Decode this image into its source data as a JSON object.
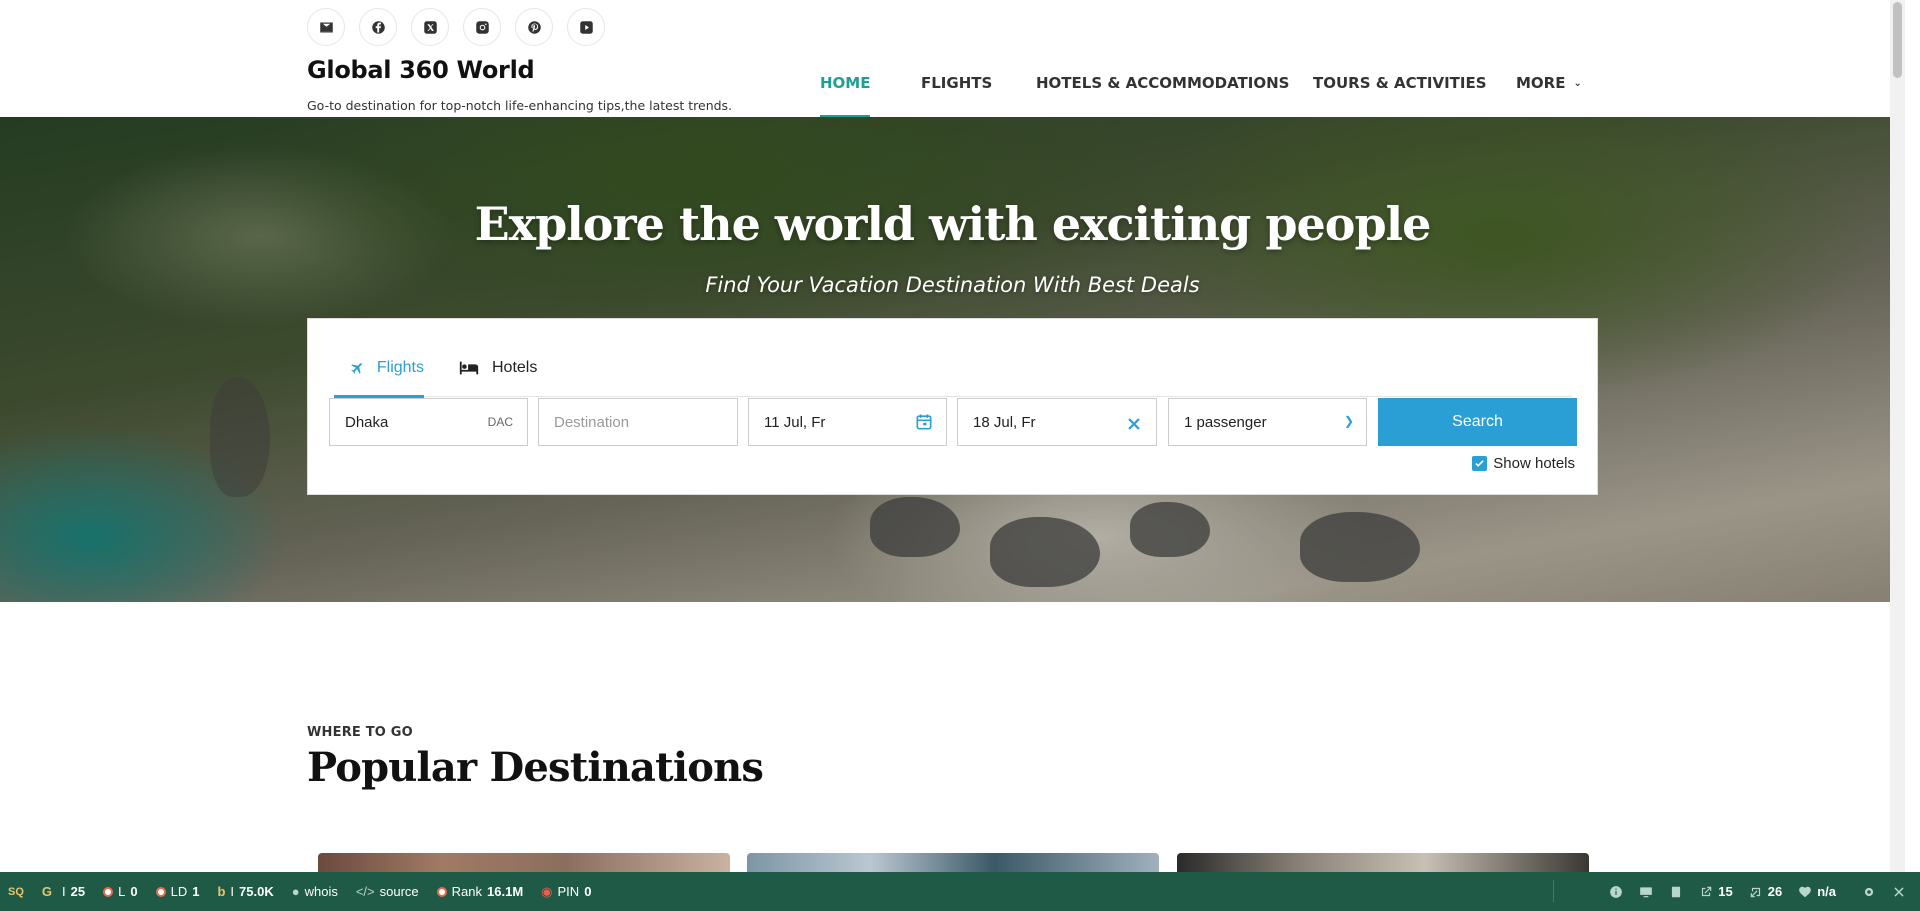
{
  "site": {
    "title": "Global 360 World",
    "tagline": "Go-to destination for top-notch life-enhancing tips,the latest trends."
  },
  "social": [
    "email-icon",
    "facebook-icon",
    "x-twitter-icon",
    "instagram-icon",
    "pinterest-icon",
    "youtube-icon"
  ],
  "nav": {
    "items": [
      {
        "label": "HOME",
        "active": true
      },
      {
        "label": "FLIGHTS"
      },
      {
        "label": "HOTELS & ACCOMMODATIONS"
      },
      {
        "label": "TOURS & ACTIVITIES"
      },
      {
        "label": "MORE"
      }
    ]
  },
  "hero": {
    "title": "Explore the world with exciting people",
    "subtitle": "Find Your Vacation Destination With Best Deals"
  },
  "search": {
    "tabs": [
      {
        "label": "Flights",
        "icon": "airplane-icon",
        "active": true
      },
      {
        "label": "Hotels",
        "icon": "bed-icon"
      }
    ],
    "origin": {
      "value": "Dhaka",
      "code": "DAC"
    },
    "destination": {
      "placeholder": "Destination"
    },
    "depart_date": "11 Jul, Fr",
    "return_date": "18 Jul, Fr",
    "passengers": "1 passenger",
    "button": "Search",
    "show_hotels": {
      "label": "Show hotels",
      "checked": true
    }
  },
  "section": {
    "kicker": "WHERE TO GO",
    "title": "Popular Destinations"
  },
  "seo_toolbar": {
    "items": [
      {
        "label": "",
        "value": "25",
        "icon": "google-icon"
      },
      {
        "label": "L",
        "value": "0"
      },
      {
        "label": "LD",
        "value": "1"
      },
      {
        "label": "",
        "value": "75.0K",
        "icon": "bing-icon"
      },
      {
        "label": "whois"
      },
      {
        "label": "source"
      },
      {
        "label": "Rank",
        "value": "16.1M"
      },
      {
        "label": "PIN",
        "value": "0"
      }
    ],
    "right": {
      "external": "15",
      "internal": "26",
      "status": "n/a"
    }
  },
  "colors": {
    "accent_teal": "#1da094",
    "accent_blue": "#2a9fd6",
    "toolbar_green": "#1f5a47"
  }
}
